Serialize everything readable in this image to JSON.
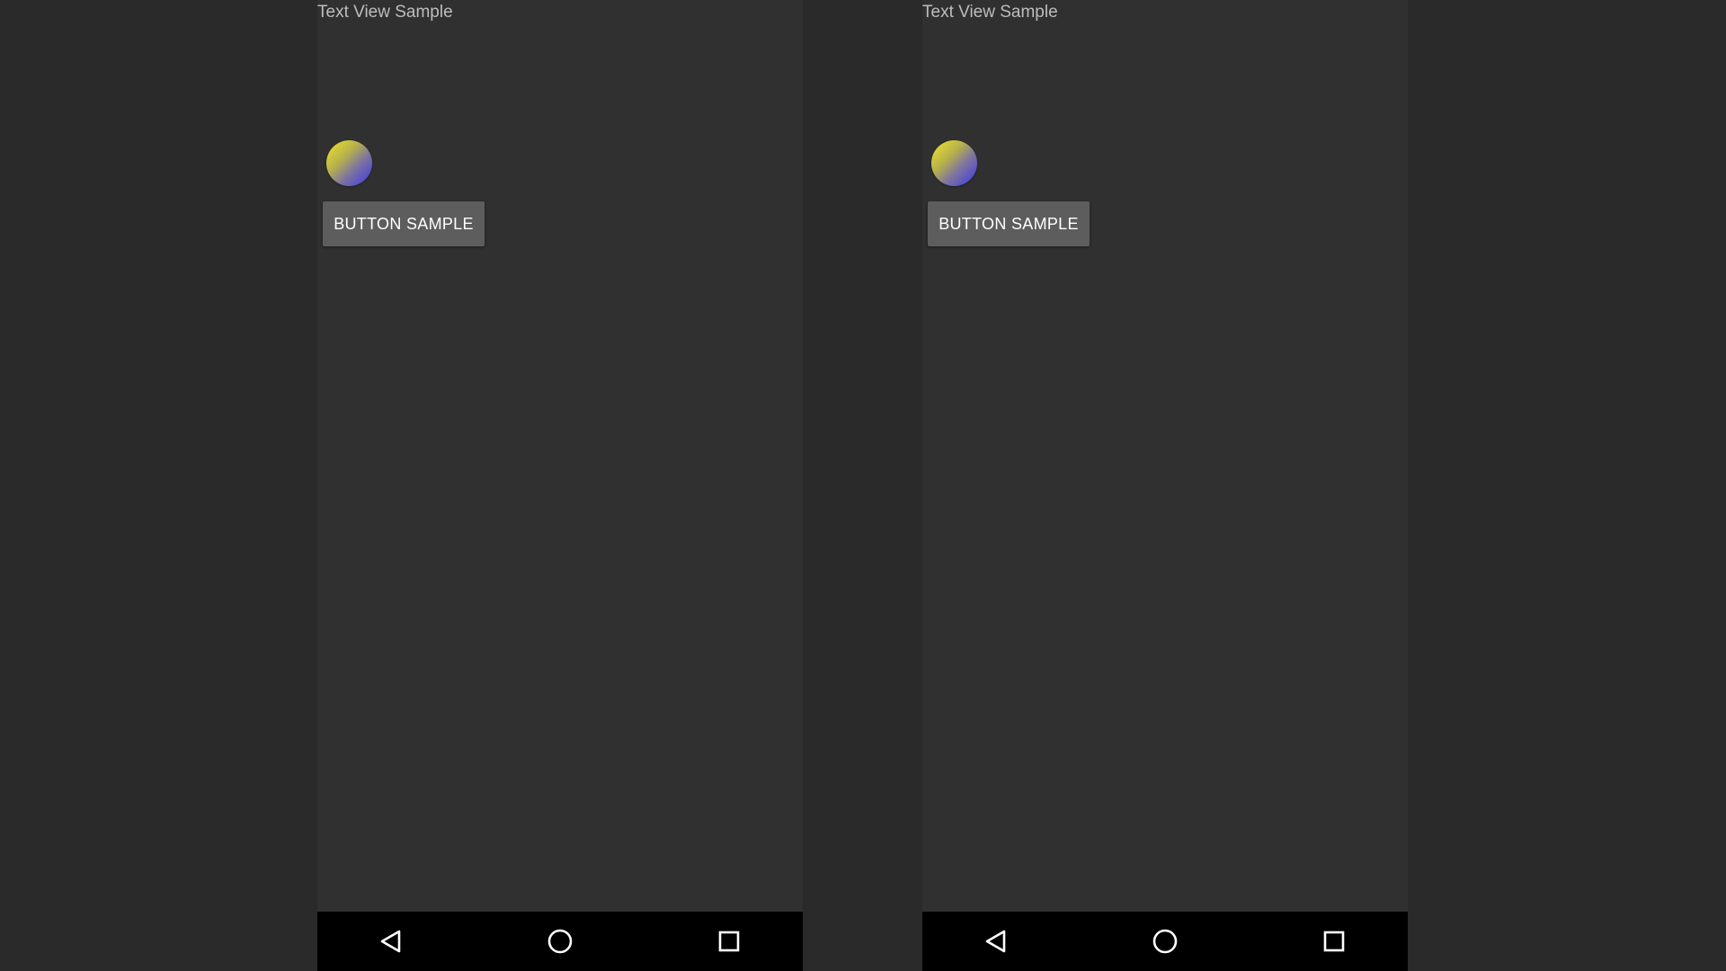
{
  "screens": [
    {
      "text_view": "Text View Sample",
      "button_label": "BUTTON SAMPLE",
      "image_view": {
        "icon": "gradient-circle-image",
        "gradient_colors": [
          "#f0e62a",
          "#3a36e6"
        ]
      },
      "nav_bar": {
        "back_icon": "back-triangle-icon",
        "home_icon": "home-circle-icon",
        "recents_icon": "recents-square-icon"
      }
    },
    {
      "text_view": "Text View Sample",
      "button_label": "BUTTON SAMPLE",
      "image_view": {
        "icon": "gradient-circle-image",
        "gradient_colors": [
          "#f0e62a",
          "#3a36e6"
        ]
      },
      "nav_bar": {
        "back_icon": "back-triangle-icon",
        "home_icon": "home-circle-icon",
        "recents_icon": "recents-square-icon"
      }
    }
  ],
  "colors": {
    "outer_background": "#2a2a2a",
    "screen_background": "#303030",
    "text_color": "#bdbdbd",
    "button_background": "#5d5d5d",
    "button_text": "#ffffff",
    "nav_bar_background": "#000000",
    "nav_icon_color": "#ffffff"
  }
}
